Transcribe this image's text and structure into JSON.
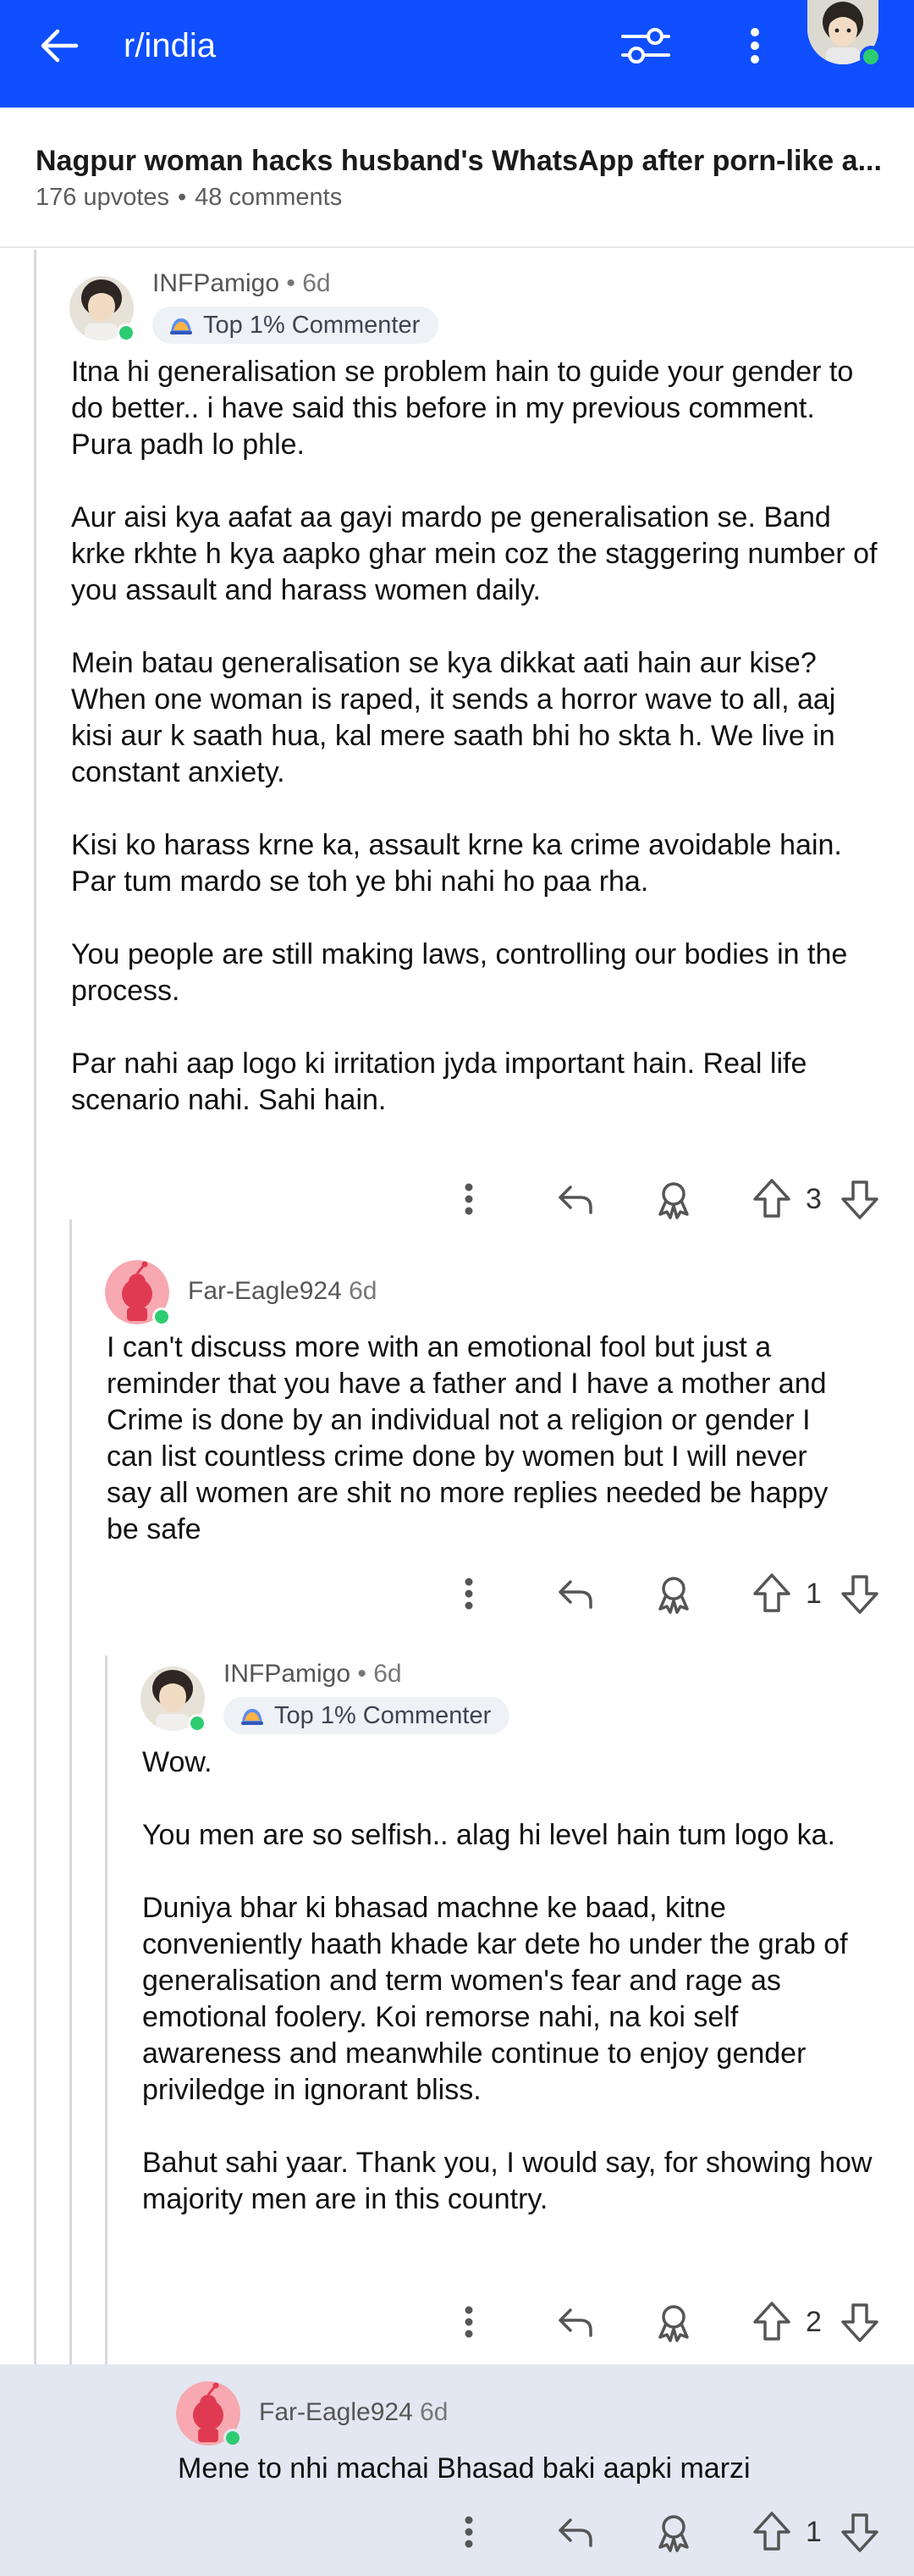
{
  "topbar": {
    "subreddit": "r/india",
    "icons": [
      "back-arrow-icon",
      "filter-icon",
      "more-vertical-icon",
      "user-avatar"
    ]
  },
  "post": {
    "title": "Nagpur woman hacks husband's WhatsApp after porn-like a...",
    "upvotes": "176 upvotes",
    "separator": "•",
    "comments": "48 comments"
  },
  "comments": [
    {
      "user": "INFPamigo",
      "age": "• 6d",
      "badge": "Top 1% Commenter",
      "paragraphs": [
        "Itna hi generalisation se problem hain to guide your gender to do better.. i have said this before in my previous comment. Pura padh lo phle.",
        "Aur aisi kya aafat aa gayi mardo pe generalisation se. Band krke rkhte h kya aapko ghar mein coz the staggering number of you assault and harass women daily.",
        "Mein batau generalisation se kya dikkat aati hain aur kise? When one woman is raped, it sends a horror wave to all, aaj kisi aur k saath hua, kal mere saath bhi ho skta h. We live in constant anxiety.",
        "Kisi ko harass krne ka, assault krne ka crime avoidable hain. Par tum mardo se toh ye bhi nahi ho paa rha.",
        "You people are still making laws, controlling our bodies in the process.",
        "Par nahi aap logo ki irritation jyda important hain. Real life scenario nahi. Sahi hain."
      ],
      "votes": "3"
    },
    {
      "user": "Far-Eagle924",
      "age": "6d",
      "paragraphs": [
        "I can't discuss more with an emotional fool but just a reminder that you have a father and I have a mother and Crime is done by an individual not a religion or gender I can list countless crime done by women but I will never say all women are shit no more replies needed be happy be safe"
      ],
      "votes": "1"
    },
    {
      "user": "INFPamigo",
      "age": "• 6d",
      "badge": "Top 1% Commenter",
      "paragraphs": [
        "Wow.",
        "You men are so selfish.. alag hi level hain tum logo ka.",
        "Duniya bhar ki bhasad machne ke baad, kitne conveniently haath khade kar dete ho under the grab of generalisation and term women's fear and rage as emotional foolery. Koi remorse nahi, na koi self awareness and meanwhile continue to enjoy gender priviledge in ignorant bliss.",
        "Bahut sahi yaar. Thank you, I would say, for showing how majority men are in this country."
      ],
      "votes": "2"
    },
    {
      "user": "Far-Eagle924",
      "age": "6d",
      "paragraphs": [
        "Mene to nhi machai Bhasad baki aapki marzi"
      ],
      "votes": "1"
    }
  ],
  "action_icons": [
    "more-vertical-icon",
    "reply-icon",
    "award-icon",
    "upvote-icon",
    "downvote-icon"
  ],
  "colors": {
    "topbar": "#0f4fff",
    "online": "#2ecc71",
    "highlight": "#e2e7f1"
  }
}
